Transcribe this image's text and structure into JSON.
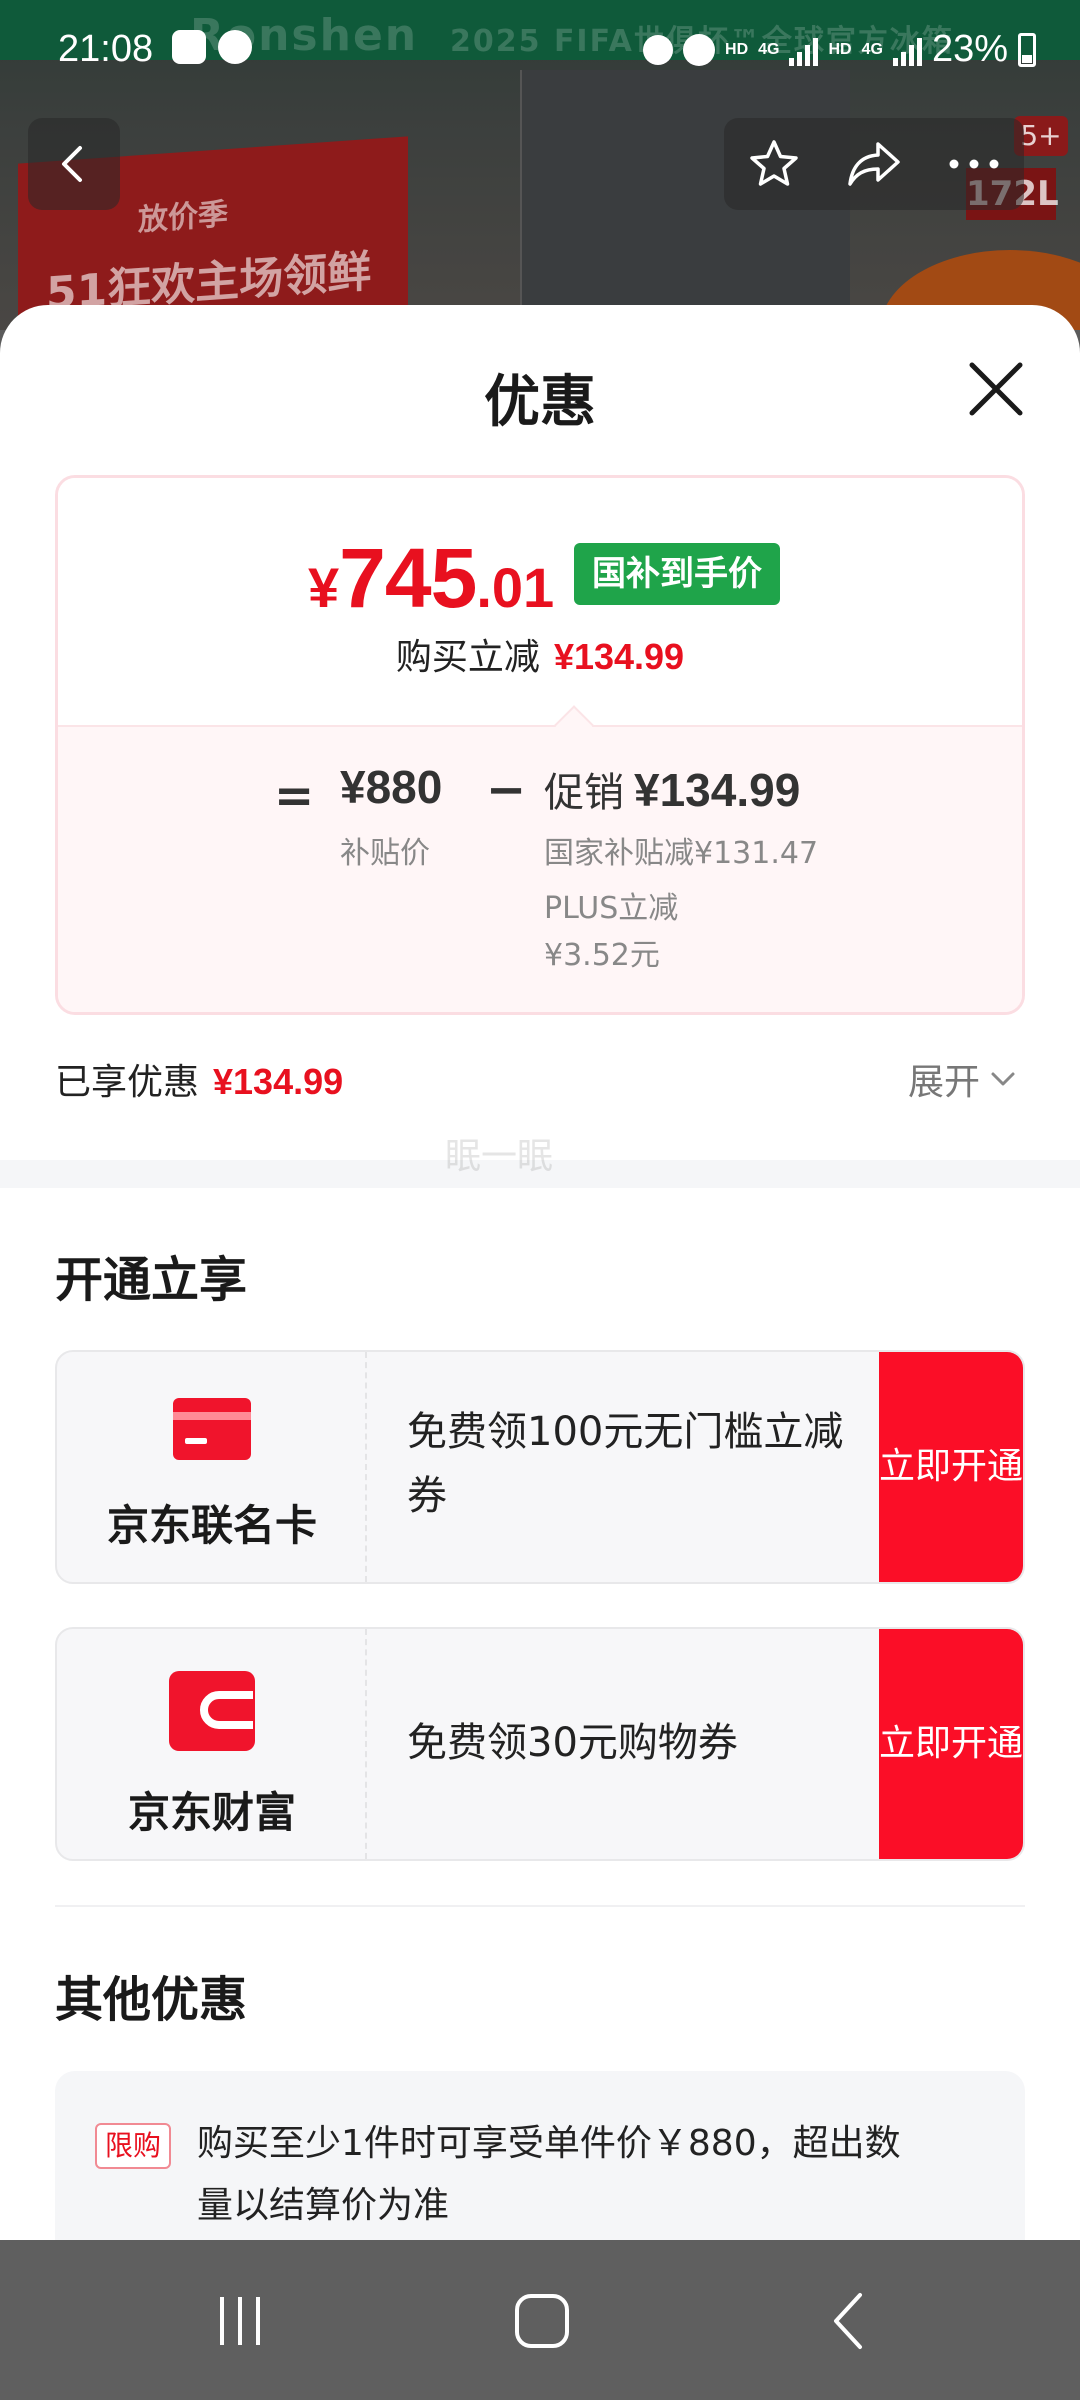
{
  "status_bar": {
    "time": "21:08",
    "hd1": "HD",
    "net": "4G",
    "hd2": "HD",
    "net2": "4G",
    "battery": "23%"
  },
  "background": {
    "brand_text": "Ronshen",
    "event_text": "2025 FIFA世俱杯™全球官方冰箱",
    "poster_line1": "放价季",
    "poster_line2": "51狂欢主场领鲜",
    "capacity_badge": "172L",
    "count_badge": "5+"
  },
  "sheet": {
    "title": "优惠",
    "price": {
      "yen": "¥",
      "integer": "745",
      "decimal": ".01",
      "tag": "国补到手价",
      "save_label": "购买立减",
      "save_amount": "¥134.99"
    },
    "breakdown": {
      "equals": "=",
      "subsidy_price": "¥880",
      "subsidy_label": "补贴价",
      "minus": "−",
      "promo_label": "促销",
      "promo_amount": "¥134.99",
      "detail1": "国家补贴减¥131.47",
      "detail2": "PLUS立减",
      "detail3": "¥3.52元"
    },
    "enjoyed_label": "已享优惠",
    "enjoyed_amount": "¥134.99",
    "expand_label": "展开",
    "watermark": "眠一眠",
    "open_section_title": "开通立享",
    "offers": [
      {
        "brand": "京东联名卡",
        "desc": "免费领100元无门槛立减券",
        "cta": "立即开通",
        "icon": "credit-card-icon"
      },
      {
        "brand": "京东财富",
        "desc": "免费领30元购物券",
        "cta": "立即开通",
        "icon": "jd-wealth-icon"
      }
    ],
    "other_section_title": "其他优惠",
    "other": {
      "tag": "限购",
      "text": "购买至少1件时可享受单件价￥880，超出数量以结算价为准"
    }
  },
  "colors": {
    "accent_red": "#e8101f",
    "cta_red": "#fb0e27",
    "gov_green": "#1fa44a"
  }
}
